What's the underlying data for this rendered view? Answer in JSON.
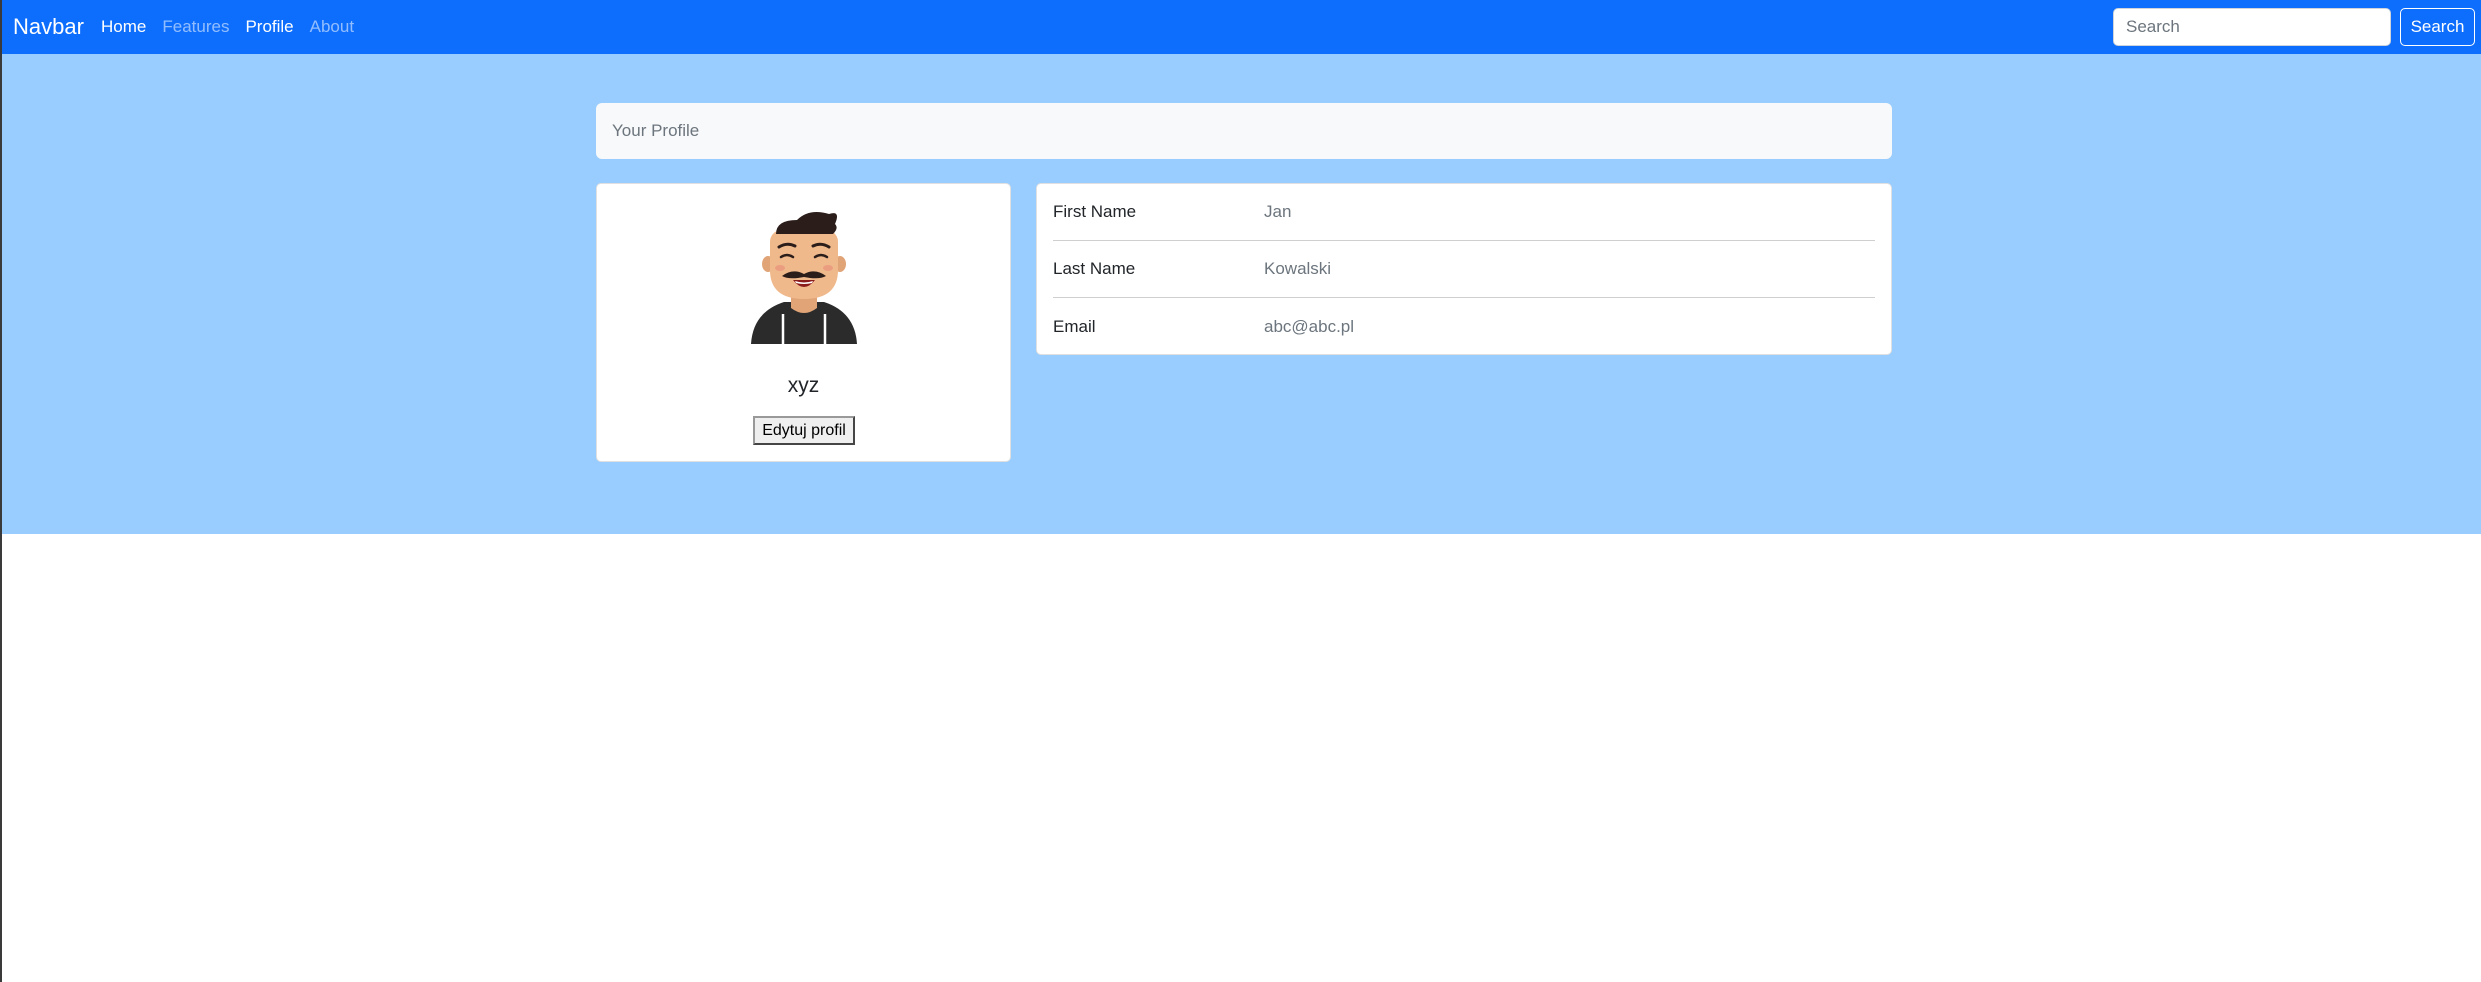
{
  "navbar": {
    "brand": "Navbar",
    "links": [
      {
        "label": "Home",
        "state": "active"
      },
      {
        "label": "Features",
        "state": "muted"
      },
      {
        "label": "Profile",
        "state": "active"
      },
      {
        "label": "About",
        "state": "muted"
      }
    ],
    "search_placeholder": "Search",
    "search_button": "Search"
  },
  "breadcrumb": {
    "label": "Your Profile"
  },
  "profile": {
    "username": "xyz",
    "edit_button": "Edytuj profil",
    "avatar_icon": "man-avatar-icon"
  },
  "details": [
    {
      "label": "First Name",
      "value": "Jan"
    },
    {
      "label": "Last Name",
      "value": "Kowalski"
    },
    {
      "label": "Email",
      "value": "abc@abc.pl"
    }
  ],
  "colors": {
    "navbar_bg": "#0d6efd",
    "hero_bg": "#99ccff",
    "breadcrumb_bg": "#f8f9fa",
    "card_bg": "#ffffff"
  }
}
